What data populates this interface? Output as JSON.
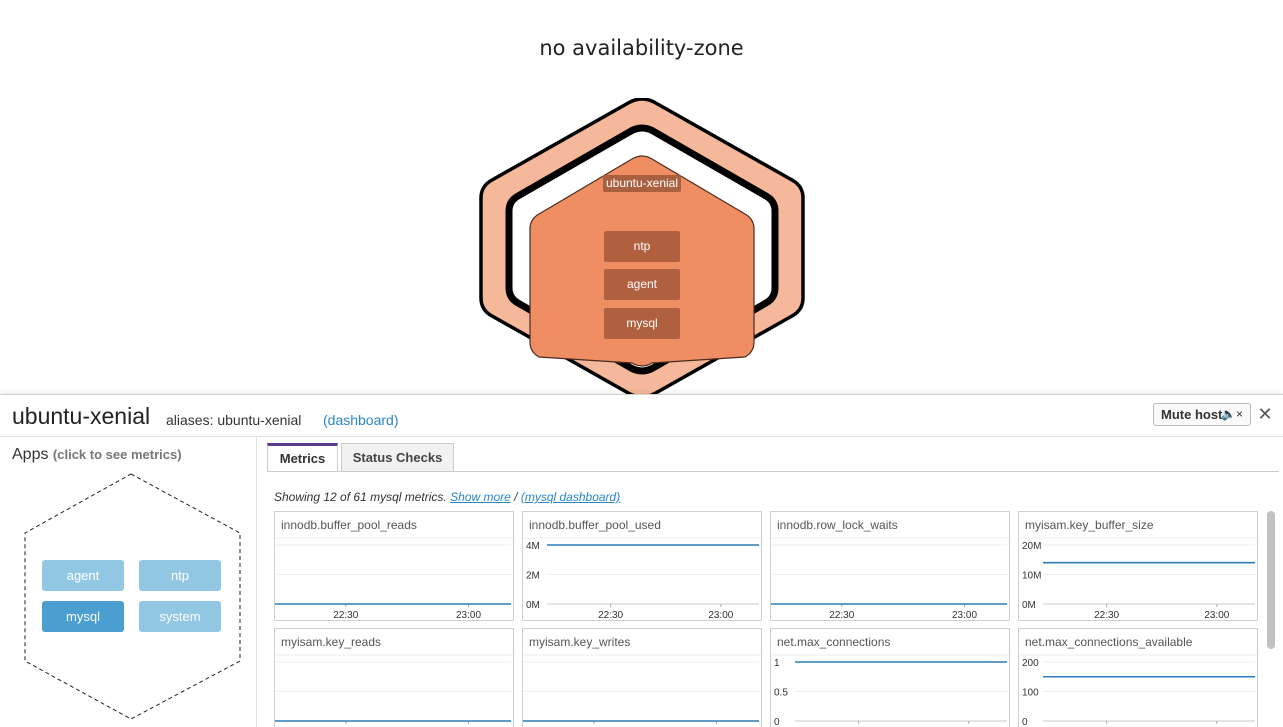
{
  "map": {
    "zone_title": "no availability-zone",
    "host_label": "ubuntu-xenial",
    "apps": [
      "ntp",
      "agent",
      "mysql"
    ],
    "colors": {
      "outer_ring": "#f5b89b",
      "inner_hex": "#ef8e63",
      "app_box": "#b0603f",
      "outline": "#000000"
    }
  },
  "panel": {
    "host_name": "ubuntu-xenial",
    "aliases_text": "aliases: ubuntu-xenial",
    "dashboard_link": "(dashboard)",
    "mute_label": "Mute host",
    "mute_icon": "speaker-muted-icon",
    "close_icon": "close-icon",
    "apps_title": "Apps",
    "apps_hint": "(click to see metrics)",
    "app_pills": [
      {
        "label": "agent",
        "selected": false
      },
      {
        "label": "ntp",
        "selected": false
      },
      {
        "label": "mysql",
        "selected": true
      },
      {
        "label": "system",
        "selected": false
      }
    ],
    "pill_colors": {
      "normal": "#92c7e3",
      "selected": "#4a9fd0"
    },
    "tabs": [
      {
        "label": "Metrics",
        "active": true
      },
      {
        "label": "Status Checks",
        "active": false
      }
    ],
    "showing_text": "Showing 12 of 61 mysql metrics.",
    "show_more": "Show more",
    "separator": "/",
    "mysql_dashboard": "(mysql dashboard)"
  },
  "graphs": [
    {
      "title": "innodb.buffer_pool_reads",
      "y_ticks": [],
      "x_ticks": [
        "22:30",
        "23:00"
      ],
      "level": 0.0,
      "line_color": "#2b7db8"
    },
    {
      "title": "innodb.buffer_pool_used",
      "y_ticks": [
        "4M",
        "2M",
        "0M"
      ],
      "x_ticks": [
        "22:30",
        "23:00"
      ],
      "level": 1.0,
      "line_color": "#2b7db8"
    },
    {
      "title": "innodb.row_lock_waits",
      "y_ticks": [],
      "x_ticks": [
        "22:30",
        "23:00"
      ],
      "level": 0.0,
      "line_color": "#2b7db8"
    },
    {
      "title": "myisam.key_buffer_size",
      "y_ticks": [
        "20M",
        "10M",
        "0M"
      ],
      "x_ticks": [
        "22:30",
        "23:00"
      ],
      "level": 0.7,
      "line_color": "#2b7db8"
    },
    {
      "title": "myisam.key_reads",
      "y_ticks": [],
      "x_ticks": [],
      "level": 0.0,
      "line_color": "#2b7db8"
    },
    {
      "title": "myisam.key_writes",
      "y_ticks": [],
      "x_ticks": [],
      "level": 0.0,
      "line_color": "#2b7db8"
    },
    {
      "title": "net.max_connections",
      "y_ticks": [
        "1",
        "0.5",
        "0"
      ],
      "x_ticks": [],
      "level": 1.0,
      "line_color": "#2b7db8"
    },
    {
      "title": "net.max_connections_available",
      "y_ticks": [
        "200",
        "100",
        "0"
      ],
      "x_ticks": [],
      "level": 0.75,
      "line_color": "#2b7db8"
    }
  ]
}
